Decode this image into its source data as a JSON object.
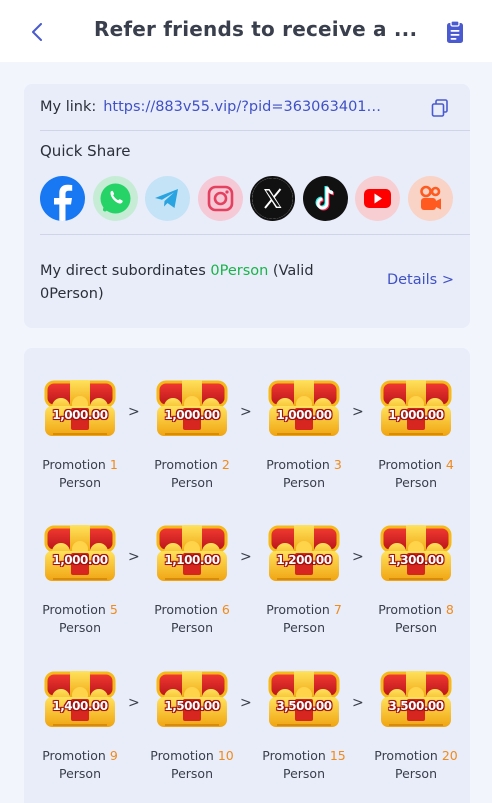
{
  "header": {
    "title": "Refer friends to receive a ..."
  },
  "link": {
    "label": "My link:",
    "url": "https://883v55.vip/?pid=3630634011&..."
  },
  "quick_share": {
    "label": "Quick Share",
    "items": [
      {
        "name": "facebook",
        "icon": "facebook-icon",
        "color": "#1877f2"
      },
      {
        "name": "whatsapp",
        "icon": "whatsapp-icon",
        "color": "#25d366"
      },
      {
        "name": "telegram",
        "icon": "telegram-icon",
        "color": "#2aa3e1"
      },
      {
        "name": "instagram",
        "icon": "instagram-icon",
        "color": "#e4405f"
      },
      {
        "name": "x",
        "icon": "x-icon",
        "color": "#000000"
      },
      {
        "name": "tiktok",
        "icon": "tiktok-icon",
        "color": "#000000"
      },
      {
        "name": "youtube",
        "icon": "youtube-icon",
        "color": "#ff0000"
      },
      {
        "name": "kuaishou",
        "icon": "kuaishou-icon",
        "color": "#ff5a1f"
      }
    ]
  },
  "subordinates": {
    "prefix": "My direct subordinates ",
    "count": "0Person",
    "suffix": " (Valid 0Person)",
    "details_label": "Details >"
  },
  "tiers": [
    {
      "label": "Promotion",
      "num": "1",
      "unit": "Person",
      "amount": "1,000.00"
    },
    {
      "label": "Promotion",
      "num": "2",
      "unit": "Person",
      "amount": "1,000.00"
    },
    {
      "label": "Promotion",
      "num": "3",
      "unit": "Person",
      "amount": "1,000.00"
    },
    {
      "label": "Promotion",
      "num": "4",
      "unit": "Person",
      "amount": "1,000.00"
    },
    {
      "label": "Promotion",
      "num": "5",
      "unit": "Person",
      "amount": "1,000.00"
    },
    {
      "label": "Promotion",
      "num": "6",
      "unit": "Person",
      "amount": "1,100.00"
    },
    {
      "label": "Promotion",
      "num": "7",
      "unit": "Person",
      "amount": "1,200.00"
    },
    {
      "label": "Promotion",
      "num": "8",
      "unit": "Person",
      "amount": "1,300.00"
    },
    {
      "label": "Promotion",
      "num": "9",
      "unit": "Person",
      "amount": "1,400.00"
    },
    {
      "label": "Promotion",
      "num": "10",
      "unit": "Person",
      "amount": "1,500.00"
    },
    {
      "label": "Promotion",
      "num": "15",
      "unit": "Person",
      "amount": "3,500.00"
    },
    {
      "label": "Promotion",
      "num": "20",
      "unit": "Person",
      "amount": "3,500.00"
    }
  ],
  "arrow_glyph": ">",
  "colors": {
    "accent": "#3f51c6",
    "green": "#19b34a",
    "orange": "#f08a1b"
  }
}
